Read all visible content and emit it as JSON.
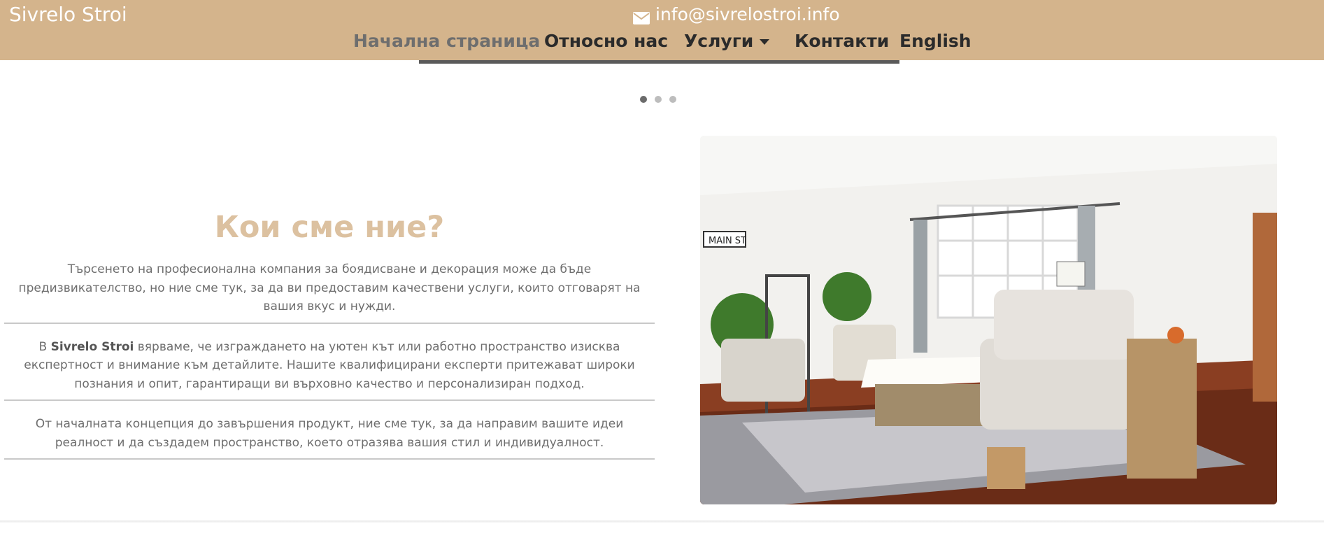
{
  "header": {
    "brand": "Sivrelo Stroi",
    "email": "info@sivrelostroi.info",
    "email_icon": "envelope-icon",
    "nav": [
      {
        "label": "Начална страница",
        "active": true
      },
      {
        "label": "Относно нас",
        "active": false
      },
      {
        "label": "Услуги",
        "active": false,
        "has_dropdown": true
      },
      {
        "label": "Контакти",
        "active": false
      },
      {
        "label": "English",
        "active": false
      }
    ]
  },
  "slider": {
    "slide_count": 3,
    "active_index": 0
  },
  "about": {
    "title": "Кои сме ние?",
    "p1": "Търсенето на професионална компания за боядисване и декорация може да бъде предизвикателство, но ние сме тук, за да ви предоставим качествени услуги, които отговарят на вашия вкус и нужди.",
    "p2_prefix": "В ",
    "p2_brand": "Sivrelo Stroi",
    "p2_rest": " вярваме, че изграждането на уютен кът или работно пространство изисква експертност и внимание към детайлите. Нашите квалифицирани експерти притежават широки познания и опит, гарантиращи ви върховно качество и персонализиран подход.",
    "p3": "От началната концепция до завършения продукт, ние сме тук, за да направим вашите идеи реалност и да създадем пространство, което отразява вашия стил и индивидуалност.",
    "photo_sign": "MAIN ST"
  },
  "colors": {
    "header_bg": "#d4b48c",
    "title": "#dcc1a0",
    "body_text": "#6e6e6e",
    "nav_text": "#2b2b2b",
    "nav_active": "#6e6e6e"
  }
}
